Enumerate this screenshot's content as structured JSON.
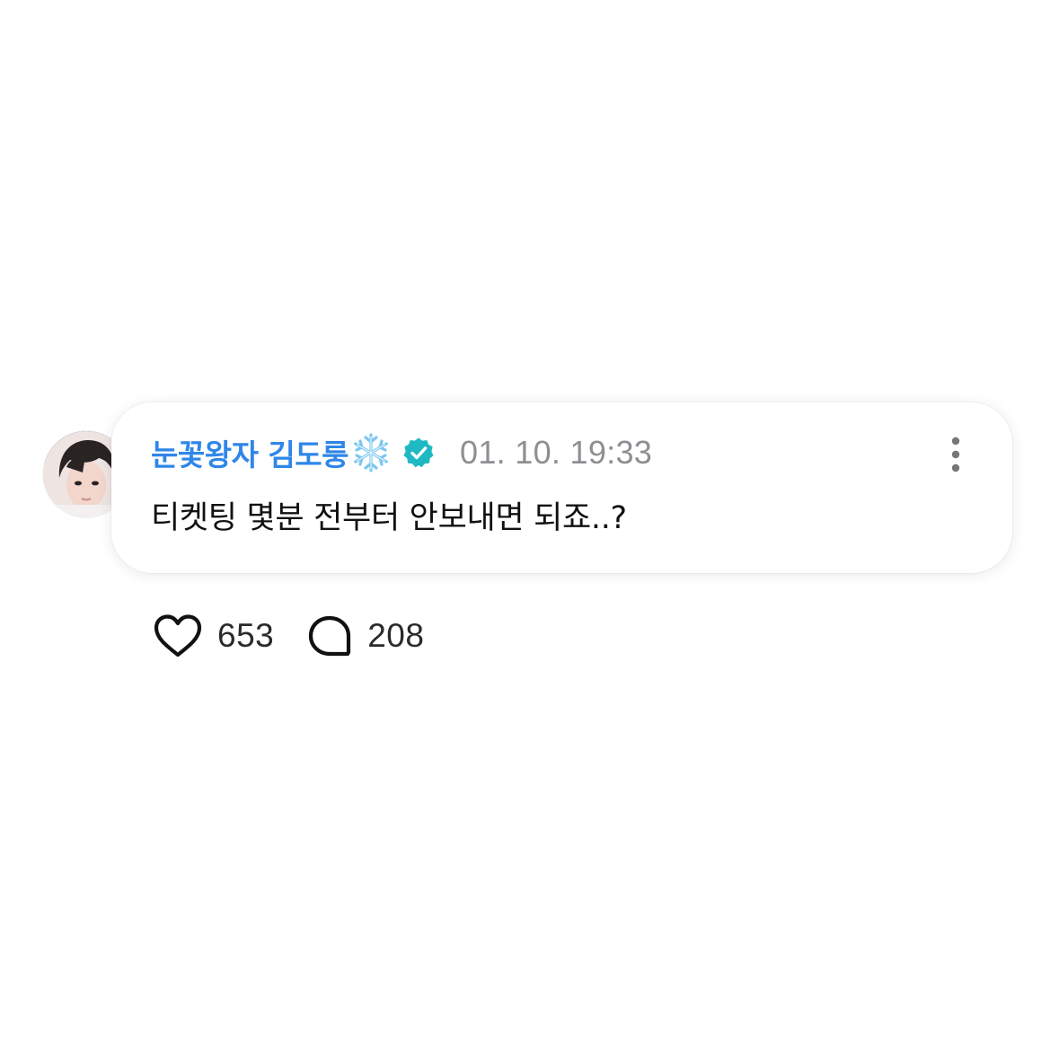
{
  "comment": {
    "author": "눈꽃왕자 김도룽",
    "author_icon": "snowflake-icon",
    "verified_icon": "verified-badge-icon",
    "timestamp": "01. 10. 19:33",
    "text": "티켓팅 몇분 전부터 안보내면 되죠..?",
    "more_icon": "more-vertical-icon"
  },
  "actions": {
    "like_icon": "heart-icon",
    "like_count": "653",
    "reply_icon": "comment-bubble-icon",
    "reply_count": "208"
  },
  "colors": {
    "author_name": "#2f86e8",
    "verified": "#1fb9c4",
    "timestamp": "#8e8e93",
    "text": "#111111"
  }
}
